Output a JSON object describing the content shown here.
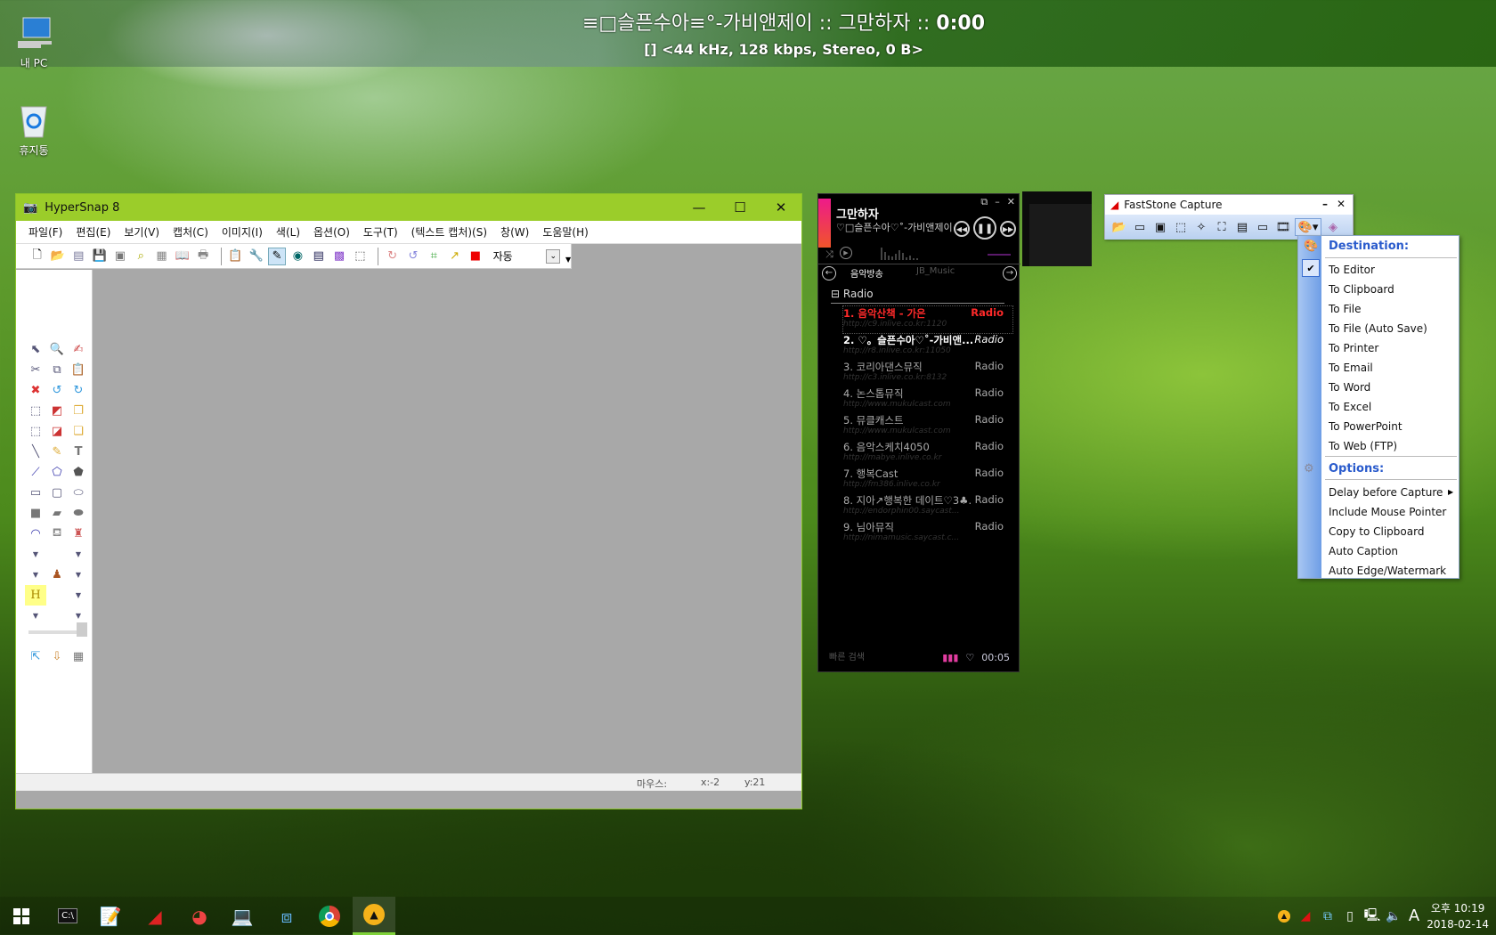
{
  "now_playing": {
    "title_prefix": "≡□슬픈수아≡°-가비앤제이 :: 그만하자 :: ",
    "time": "0:00",
    "info": "[] <44 kHz, 128 kbps, Stereo, 0 B>"
  },
  "desktop_icons": [
    {
      "label": "내 PC",
      "icon": "computer-icon"
    },
    {
      "label": "휴지통",
      "icon": "recycle-bin-icon"
    }
  ],
  "hypersnap": {
    "title": "HyperSnap 8",
    "menu": [
      "파일(F)",
      "편집(E)",
      "보기(V)",
      "캡처(C)",
      "이미지(I)",
      "색(L)",
      "옵션(O)",
      "도구(T)",
      "(텍스트 캡처)(S)",
      "창(W)",
      "도움말(H)"
    ],
    "zoom_label": "자동",
    "status": {
      "mouse_label": "마우스:",
      "x": "x:-2",
      "y": "y:21"
    }
  },
  "player": {
    "song": "그만하자",
    "artist": "♡□슬픈수아♡˚-가비앤제이",
    "tabs": [
      "음악방송",
      "JB_Music"
    ],
    "group": "Radio",
    "stations": [
      {
        "name": "1. 음악산책 - 가은",
        "category": "Radio",
        "url": "http://c9.inlive.co.kr:1120",
        "state": "active"
      },
      {
        "name": "2. ♡。슬픈수아♡˚-가비앤...",
        "category": "Radio",
        "url": "http://r8.inlive.co.kr:11050",
        "state": "playing"
      },
      {
        "name": "3. 코리아댄스뮤직",
        "category": "Radio",
        "url": "http://c3.inlive.co.kr:8132",
        "state": ""
      },
      {
        "name": "4. 논스톱뮤직",
        "category": "Radio",
        "url": "http://www.mukulcast.com",
        "state": ""
      },
      {
        "name": "5. 뮤클캐스트",
        "category": "Radio",
        "url": "http://www.mukulcast.com",
        "state": ""
      },
      {
        "name": "6. 음악스케치4050",
        "category": "Radio",
        "url": "http://mabye.inlive.co.kr",
        "state": ""
      },
      {
        "name": "7. 행복Cast",
        "category": "Radio",
        "url": "http://fm386.inlive.co.kr",
        "state": ""
      },
      {
        "name": "8. 지아↗행복한 데이트♡3♣...",
        "category": "Radio",
        "url": "http://endorphin00.saycast...",
        "state": ""
      },
      {
        "name": "9. 님아뮤직",
        "category": "Radio",
        "url": "http://nimamusic.saycast.c...",
        "state": ""
      }
    ],
    "search_placeholder": "빠른 검색",
    "elapsed": "00:05"
  },
  "faststone": {
    "title": "FastStone Capture",
    "menu": {
      "destination_header": "Destination:",
      "destinations": [
        "To Editor",
        "To Clipboard",
        "To File",
        "To File (Auto Save)",
        "To Printer",
        "To Email",
        "To Word",
        "To Excel",
        "To PowerPoint",
        "To Web (FTP)"
      ],
      "checked": "To Editor",
      "options_header": "Options:",
      "options": [
        "Delay before Capture",
        "Include Mouse Pointer",
        "Copy to Clipboard",
        "Auto Caption",
        "Auto Edge/Watermark"
      ]
    }
  },
  "taskbar": {
    "apps": [
      "start",
      "command-prompt",
      "notepad",
      "faststone-capture",
      "partition-tool",
      "network-admin",
      "network-map",
      "chrome",
      "aimp"
    ],
    "ime": "A",
    "clock_time": "오후 10:19",
    "clock_date": "2018-02-14"
  }
}
